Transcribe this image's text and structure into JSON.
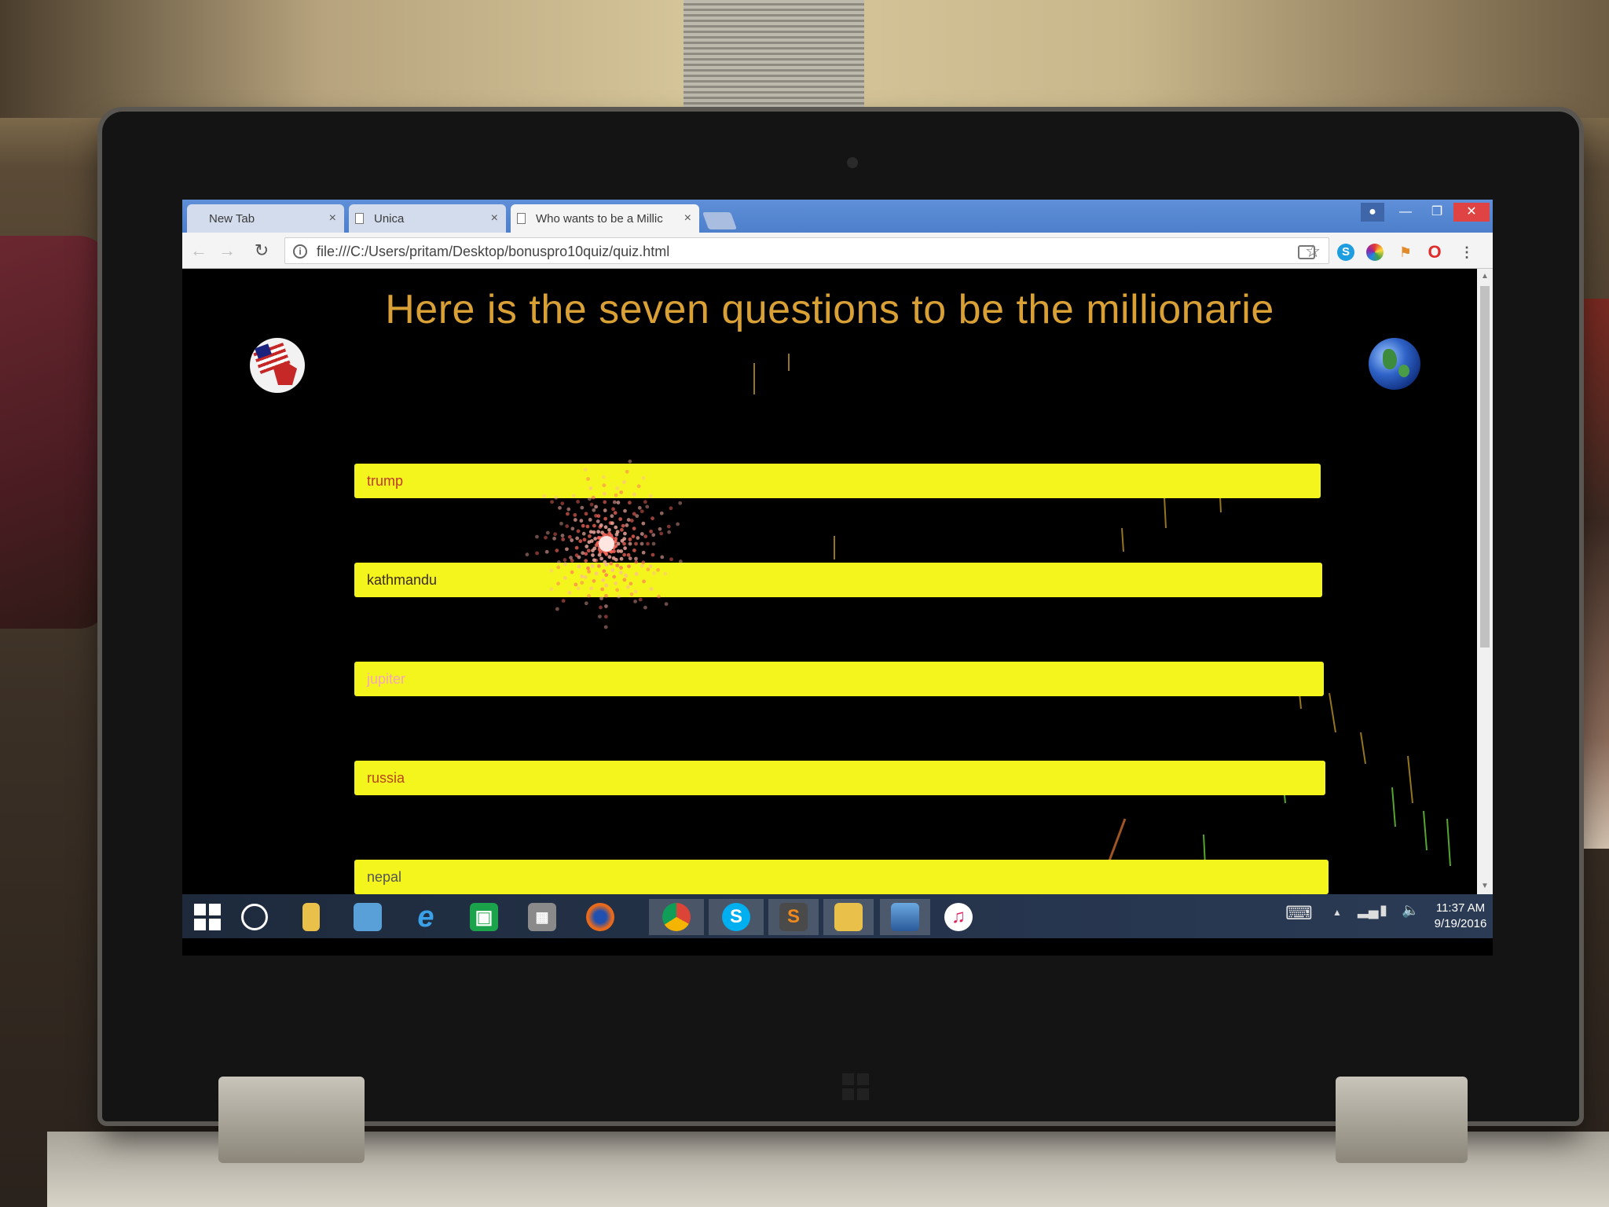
{
  "browser": {
    "tabs": [
      {
        "label": "New Tab"
      },
      {
        "label": "Unica"
      },
      {
        "label": "Who wants to be a Millic"
      }
    ],
    "url": "file:///C:/Users/pritam/Desktop/bonuspro10quiz/quiz.html"
  },
  "page": {
    "title": "Here is the seven questions to be the millionarie",
    "answers": [
      {
        "label": "trump"
      },
      {
        "label": "kathmandu"
      },
      {
        "label": "jupiter"
      },
      {
        "label": "russia"
      },
      {
        "label": "nepal"
      }
    ]
  },
  "taskbar": {
    "time": "11:37 AM",
    "date": "9/19/2016",
    "pinned": [
      "start",
      "cortana",
      "file-explorer",
      "remote-desktop",
      "internet-explorer",
      "store",
      "calculator",
      "firefox",
      "chrome",
      "skype",
      "sublime-text",
      "folder",
      "photos",
      "itunes"
    ]
  },
  "colors": {
    "title": "#d9a035",
    "answer_bg": "#f5f51e",
    "page_bg": "#000000"
  }
}
